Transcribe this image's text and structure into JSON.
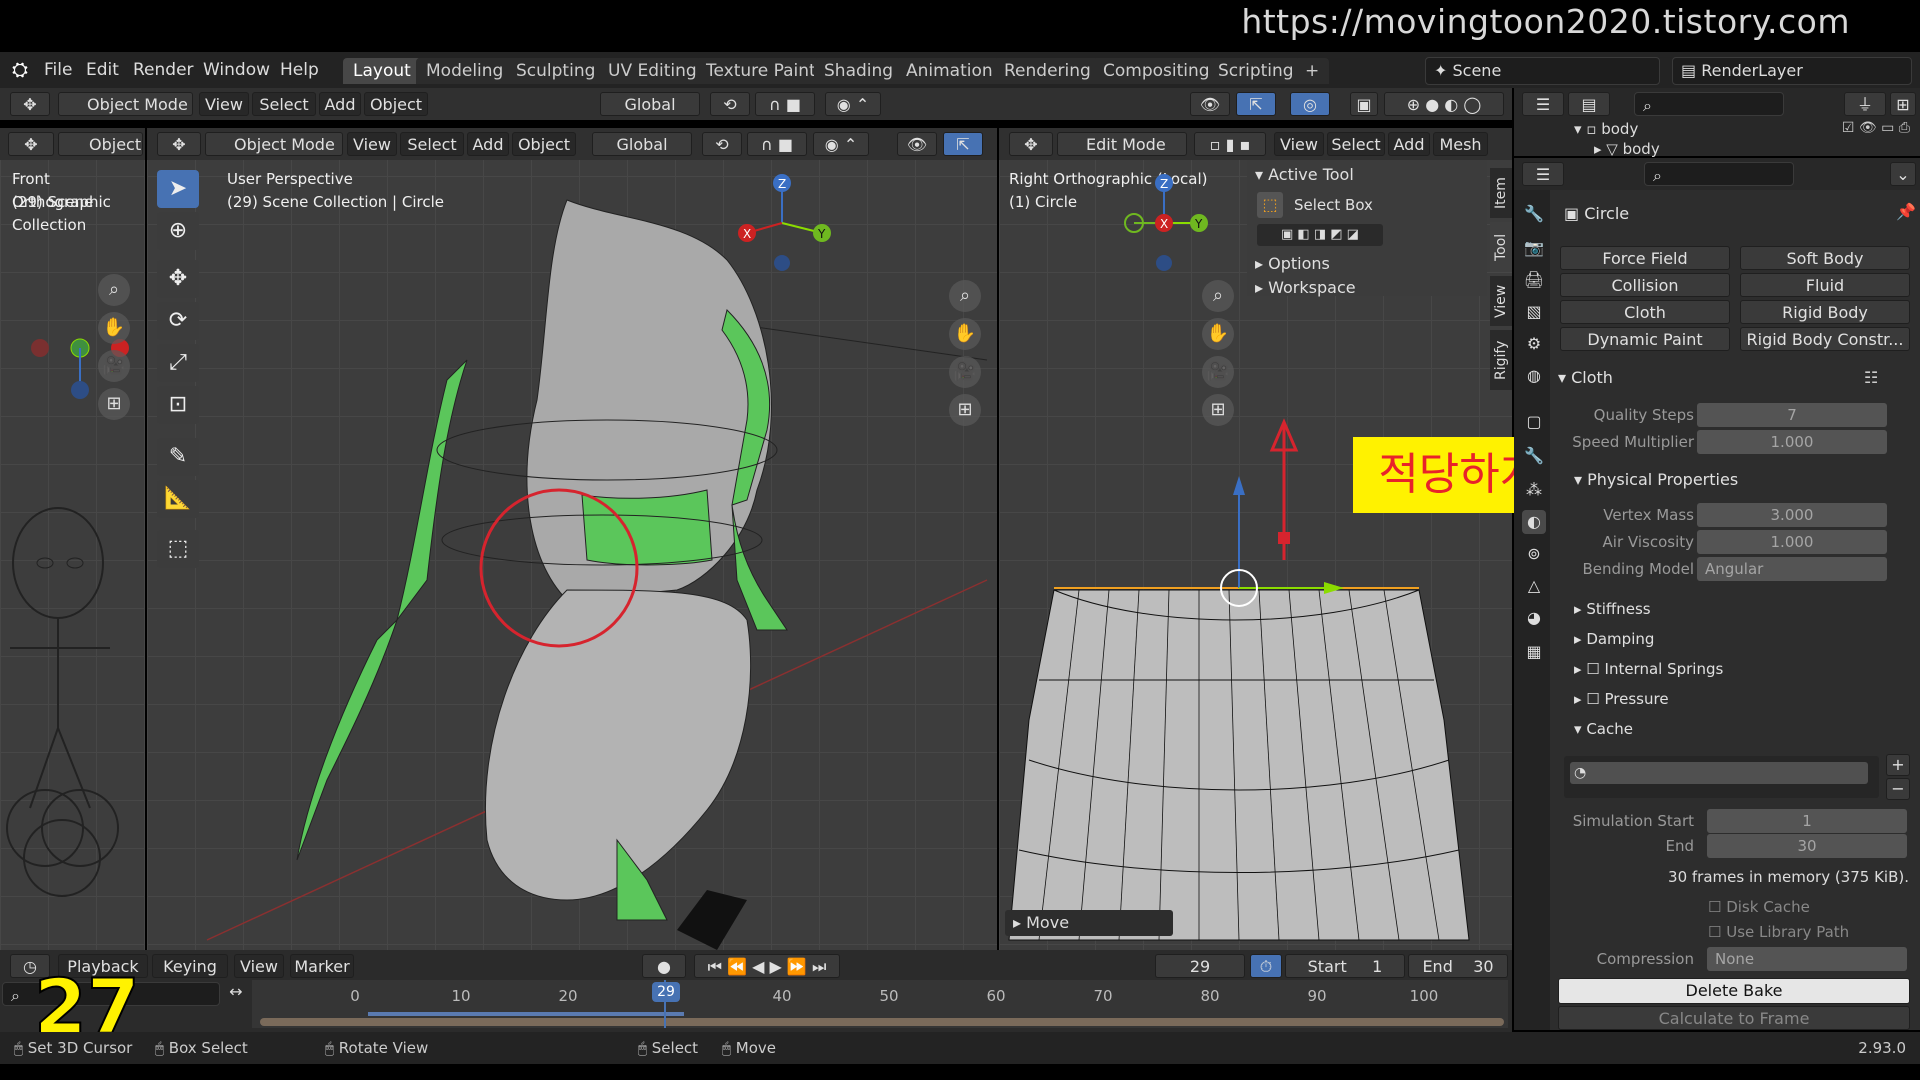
{
  "watermark_url": "https://movingtoon2020.tistory.com",
  "menu": [
    "File",
    "Edit",
    "Render",
    "Window",
    "Help"
  ],
  "workspaces": [
    "Layout",
    "Modeling",
    "Sculpting",
    "UV Editing",
    "Texture Paint",
    "Shading",
    "Animation",
    "Rendering",
    "Compositing",
    "Scripting",
    "+"
  ],
  "scene": "Scene",
  "render_layer": "RenderLayer",
  "header_row": {
    "mode": "Object Mode",
    "view": "View",
    "select": "Select",
    "add": "Add",
    "object": "Object",
    "orientation": "Global"
  },
  "left_vp": {
    "mode": "Object I",
    "line1": "Front Orthographic",
    "line2": "(29) Scene Collection"
  },
  "mid_vp": {
    "mode": "Object Mode",
    "view": "View",
    "select": "Select",
    "add": "Add",
    "object": "Object",
    "orientation": "Global",
    "line1": "User Perspective",
    "line2": "(29) Scene Collection | Circle"
  },
  "right_vp": {
    "mode": "Edit Mode",
    "view": "View",
    "select": "Select",
    "add": "Add",
    "mesh": "Mesh",
    "line1": "Right Orthographic (Local)",
    "line2": "(1) Circle",
    "active_tool": "Active Tool",
    "select_box": "Select Box",
    "options": "Options",
    "workspace": "Workspace",
    "tabs": [
      "Item",
      "Tool",
      "View",
      "Rigify"
    ],
    "move_panel": "Move"
  },
  "annotation": "적당하게 올린다",
  "outliner": {
    "row1": "body",
    "row2": "body"
  },
  "props": {
    "object": "Circle",
    "physics_buttons": [
      "Force Field",
      "Soft Body",
      "Collision",
      "Fluid",
      "Cloth",
      "Rigid Body",
      "Dynamic Paint",
      "Rigid Body Constr..."
    ],
    "cloth_header": "Cloth",
    "quality_label": "Quality Steps",
    "quality_value": "7",
    "speed_label": "Speed Multiplier",
    "speed_value": "1.000",
    "physical_props": "Physical Properties",
    "vertex_mass_label": "Vertex Mass",
    "vertex_mass_value": "3.000",
    "air_label": "Air Viscosity",
    "air_value": "1.000",
    "bending_label": "Bending Model",
    "bending_value": "Angular",
    "subpanels": [
      "Stiffness",
      "Damping",
      "Internal Springs",
      "Pressure"
    ],
    "cache": "Cache",
    "sim_start_label": "Simulation Start",
    "sim_start_value": "1",
    "end_label": "End",
    "end_value": "30",
    "memory": "30 frames in memory (375 KiB).",
    "disk_cache": "Disk Cache",
    "library_path": "Use Library Path",
    "compression_label": "Compression",
    "compression_value": "None",
    "delete_bake": "Delete Bake",
    "calc_frame": "Calculate to Frame"
  },
  "timeline": {
    "playback": "Playback",
    "keying": "Keying",
    "view": "View",
    "marker": "Marker",
    "current": "29",
    "start_label": "Start",
    "start": "1",
    "end_label": "End",
    "end": "30",
    "ticks": [
      "0",
      "10",
      "20",
      "30",
      "40",
      "50",
      "60",
      "70",
      "80",
      "90",
      "100"
    ],
    "frame_badge": "29",
    "episode": "27"
  },
  "status": {
    "set_cursor": "Set 3D Cursor",
    "box_select": "Box Select",
    "rotate_view": "Rotate View",
    "select": "Select",
    "move": "Move",
    "version": "2.93.0"
  }
}
